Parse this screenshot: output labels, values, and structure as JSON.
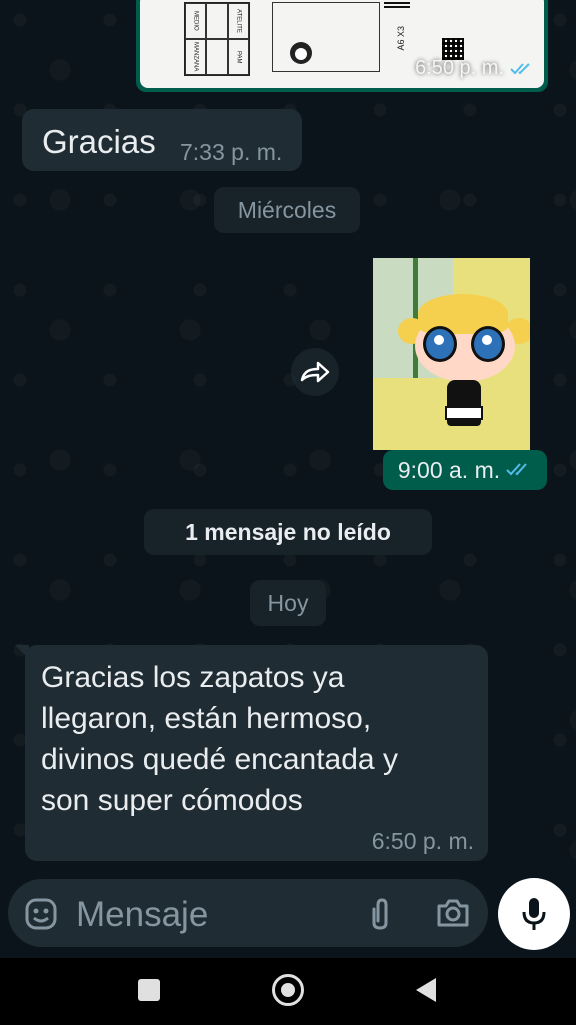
{
  "colors": {
    "background": "#0b141a",
    "incoming_bubble": "#202c33",
    "outgoing_bubble": "#005c4b",
    "timestamp": "#8696a0",
    "read_ticks": "#53bdeb"
  },
  "messages": {
    "top_image": {
      "time": "6:50 p. m.",
      "doc_labels": [
        "MEDIO",
        "MANZANA",
        "ATELITE",
        "PAM"
      ],
      "sticker_code": "A6 X3",
      "status_icon": "double-check-icon"
    },
    "msg1": {
      "text": "Gracias",
      "time": "7:33 p. m."
    },
    "day_divider_1": "Miércoles",
    "sticker": {
      "time": "9:00 a. m.",
      "status_icon": "double-check-icon",
      "forward_icon": "forward-icon"
    },
    "unread_divider": "1 mensaje no leído",
    "day_divider_2": "Hoy",
    "msg2": {
      "text": "Gracias los zapatos ya\nllegaron, están hermoso,\ndivinos quedé encantada y\nson super cómodos",
      "time": "6:50 p. m."
    }
  },
  "composer": {
    "placeholder": "Mensaje",
    "icons": [
      "emoji-icon",
      "attach-icon",
      "camera-icon",
      "mic-icon"
    ]
  },
  "navbar": {
    "icons": [
      "recents-icon",
      "home-icon",
      "back-icon"
    ]
  }
}
